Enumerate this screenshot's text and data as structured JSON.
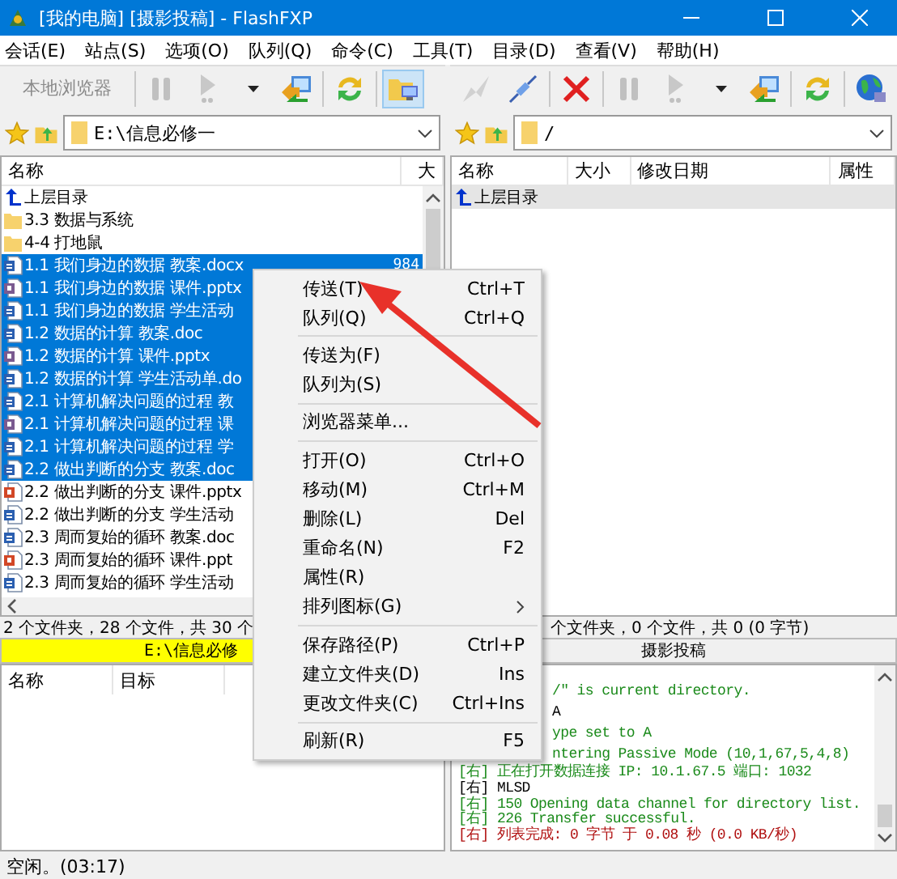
{
  "window": {
    "title": "[我的电脑]  [摄影投稿] - FlashFXP"
  },
  "menu_bar": [
    "会话(E)",
    "站点(S)",
    "选项(O)",
    "队列(Q)",
    "命令(C)",
    "工具(T)",
    "目录(D)",
    "查看(V)",
    "帮助(H)"
  ],
  "panes": [
    {
      "active": true,
      "toolbar": [
        {
          "kind": "label",
          "label": "本地浏览器",
          "disabled": true,
          "pressed": false
        },
        {
          "kind": "separator"
        },
        {
          "kind": "pause",
          "disabled": true,
          "pressed": false
        },
        {
          "kind": "play",
          "disabled": true,
          "pressed": false
        },
        {
          "kind": "caret",
          "disabled": false,
          "pressed": false
        },
        {
          "kind": "transfer",
          "disabled": false,
          "pressed": false
        },
        {
          "kind": "separator"
        },
        {
          "kind": "refresh",
          "disabled": false,
          "pressed": false
        },
        {
          "kind": "separator"
        },
        {
          "kind": "view",
          "disabled": false,
          "pressed": true
        }
      ],
      "path": "E:\\信息必修一",
      "columns": [
        "名称",
        "大"
      ],
      "rows": [
        {
          "kind": "up",
          "name": "上层目录",
          "selected": false
        },
        {
          "kind": "folder",
          "name": "3.3 数据与系统",
          "selected": false
        },
        {
          "kind": "folder",
          "name": "4-4 打地鼠",
          "selected": false
        },
        {
          "kind": "doc",
          "name": "1.1 我们身边的数据 教案.docx",
          "size": "984",
          "selected": true
        },
        {
          "kind": "ppt",
          "name": "1.1 我们身边的数据 课件.pptx",
          "selected": true
        },
        {
          "kind": "doc",
          "name": "1.1 我们身边的数据 学生活动",
          "selected": true
        },
        {
          "kind": "doc",
          "name": "1.2 数据的计算 教案.doc",
          "selected": true
        },
        {
          "kind": "ppt",
          "name": "1.2 数据的计算 课件.pptx",
          "selected": true
        },
        {
          "kind": "doc",
          "name": "1.2 数据的计算 学生活动单.do",
          "selected": true
        },
        {
          "kind": "doc",
          "name": "2.1 计算机解决问题的过程 教",
          "selected": true
        },
        {
          "kind": "ppt",
          "name": "2.1 计算机解决问题的过程 课",
          "selected": true
        },
        {
          "kind": "doc",
          "name": "2.1 计算机解决问题的过程 学",
          "selected": true
        },
        {
          "kind": "doc",
          "name": "2.2 做出判断的分支 教案.doc",
          "selected": true
        },
        {
          "kind": "pptred",
          "name": "2.2 做出判断的分支 课件.pptx",
          "selected": false
        },
        {
          "kind": "doc",
          "name": "2.2 做出判断的分支 学生活动",
          "selected": false
        },
        {
          "kind": "doc",
          "name": "2.3 周而复始的循环 教案.doc",
          "selected": false
        },
        {
          "kind": "pptred",
          "name": "2.3 周而复始的循环 课件.ppt",
          "selected": false
        },
        {
          "kind": "doc",
          "name": "2.3 周而复始的循环 学生活动",
          "selected": false
        }
      ],
      "status": "2 个文件夹，28 个文件，共 30 个",
      "path_bar": "E:\\信息必修"
    },
    {
      "active": false,
      "toolbar": [
        {
          "kind": "connect",
          "disabled": true,
          "pressed": false
        },
        {
          "kind": "disconnect",
          "disabled": false,
          "pressed": false
        },
        {
          "kind": "separator"
        },
        {
          "kind": "abort",
          "disabled": false,
          "pressed": false
        },
        {
          "kind": "separator"
        },
        {
          "kind": "pause",
          "disabled": true,
          "pressed": false
        },
        {
          "kind": "play",
          "disabled": true,
          "pressed": false
        },
        {
          "kind": "caret",
          "disabled": false,
          "pressed": false
        },
        {
          "kind": "transfer",
          "disabled": false,
          "pressed": false
        },
        {
          "kind": "separator"
        },
        {
          "kind": "refresh",
          "disabled": false,
          "pressed": false
        },
        {
          "kind": "separator"
        },
        {
          "kind": "globe",
          "disabled": false,
          "pressed": false
        }
      ],
      "path": "/",
      "columns": [
        "名称",
        "大小",
        "修改日期",
        "属性"
      ],
      "rows": [
        {
          "kind": "up",
          "name": "上层目录",
          "selected": true
        }
      ],
      "status": "个文件夹，0 个文件，共 0 (0 字节)",
      "path_bar": "摄影投稿"
    }
  ],
  "queue": {
    "columns": [
      "名称",
      "目标"
    ]
  },
  "log": [
    {
      "kind": "reply",
      "clipped": true,
      "text": "/\" is current directory."
    },
    {
      "kind": "command",
      "clipped": true,
      "text": "A"
    },
    {
      "kind": "reply",
      "clipped": true,
      "text": "ype set to A"
    },
    {
      "kind": "reply",
      "clipped": true,
      "text": "ntering Passive Mode (10,1,67,5,4,8)"
    },
    {
      "kind": "reply",
      "clipped": false,
      "text": "[右] 正在打开数据连接 IP: 10.1.67.5 端口: 1032"
    },
    {
      "kind": "command",
      "clipped": false,
      "text": "[右] MLSD"
    },
    {
      "kind": "reply",
      "clipped": false,
      "text": "[右] 150 Opening data channel for directory list."
    },
    {
      "kind": "reply",
      "clipped": false,
      "text": "[右] 226 Transfer successful."
    },
    {
      "kind": "done",
      "clipped": false,
      "text": "[右] 列表完成: 0 字节 于 0.08 秒 (0.0 KB/秒)"
    }
  ],
  "context_menu": [
    [
      {
        "label": "传送(T)",
        "shortcut": "Ctrl+T"
      },
      {
        "label": "队列(Q)",
        "shortcut": "Ctrl+Q"
      }
    ],
    [
      {
        "label": "传送为(F)"
      },
      {
        "label": "队列为(S)"
      }
    ],
    [
      {
        "label": "浏览器菜单..."
      }
    ],
    [
      {
        "label": "打开(O)",
        "shortcut": "Ctrl+O"
      },
      {
        "label": "移动(M)",
        "shortcut": "Ctrl+M"
      },
      {
        "label": "删除(L)",
        "shortcut": "Del"
      },
      {
        "label": "重命名(N)",
        "shortcut": "F2"
      },
      {
        "label": "属性(R)"
      },
      {
        "label": "排列图标(G)",
        "submenu": true
      }
    ],
    [
      {
        "label": "保存路径(P)",
        "shortcut": "Ctrl+P"
      },
      {
        "label": "建立文件夹(D)",
        "shortcut": "Ins"
      },
      {
        "label": "更改文件夹(C)",
        "shortcut": "Ctrl+Ins"
      }
    ],
    [
      {
        "label": "刷新(R)",
        "shortcut": "F5"
      }
    ]
  ],
  "status_bar": "空闲。(03:17)"
}
